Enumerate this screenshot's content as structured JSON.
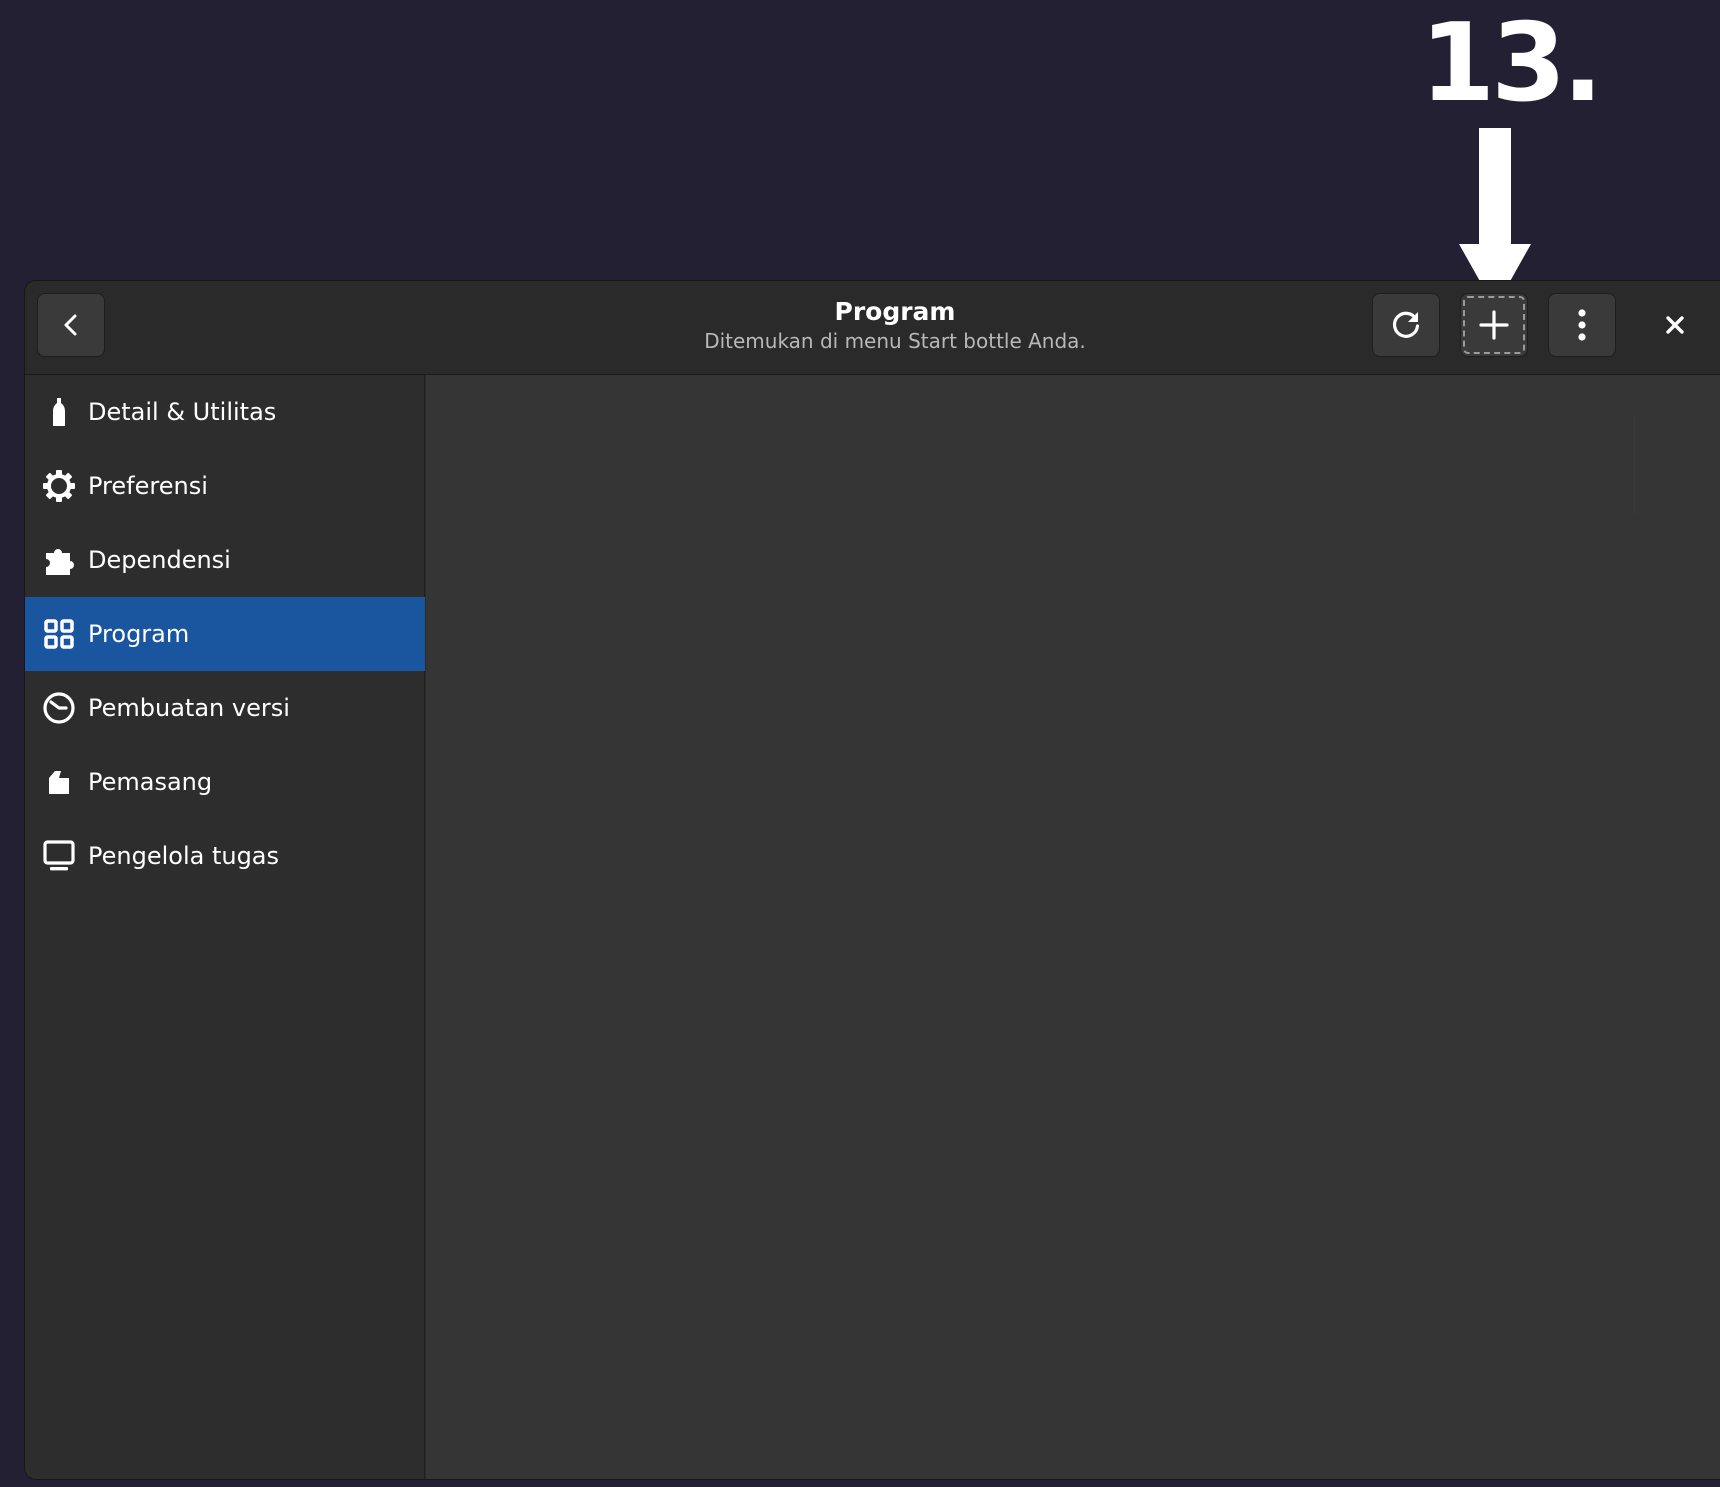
{
  "annotation": {
    "step_label": "13."
  },
  "header": {
    "title": "Program",
    "subtitle": "Ditemukan di menu Start bottle Anda.",
    "back_icon": "chevron-left-icon",
    "refresh_icon": "refresh-icon",
    "add_icon": "plus-icon",
    "menu_icon": "vertical-dots-icon",
    "close_icon": "close-icon"
  },
  "sidebar": {
    "items": [
      {
        "label": "Detail & Utilitas",
        "icon": "bottle-icon",
        "active": false
      },
      {
        "label": "Preferensi",
        "icon": "gear-icon",
        "active": false
      },
      {
        "label": "Dependensi",
        "icon": "puzzle-icon",
        "active": false
      },
      {
        "label": "Program",
        "icon": "grid-icon",
        "active": true
      },
      {
        "label": "Pembuatan versi",
        "icon": "clock-icon",
        "active": false
      },
      {
        "label": "Pemasang",
        "icon": "package-icon",
        "active": false
      },
      {
        "label": "Pengelola tugas",
        "icon": "monitor-icon",
        "active": false
      }
    ]
  },
  "colors": {
    "background": "#232034",
    "window": "#2c2c2c",
    "content": "#353535",
    "accent": "#1a55a0"
  }
}
